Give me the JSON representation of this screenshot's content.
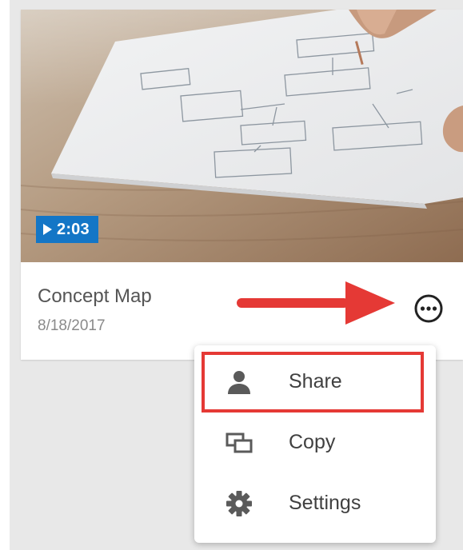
{
  "video": {
    "duration": "2:03",
    "title": "Concept Map",
    "date": "8/18/2017",
    "thumbnail_icon": "sketch-flowchart-photo"
  },
  "more_options": {
    "icon": "more-horizontal-circle-icon"
  },
  "menu": {
    "items": [
      {
        "label": "Share",
        "icon": "person-icon"
      },
      {
        "label": "Copy",
        "icon": "copy-windows-icon"
      },
      {
        "label": "Settings",
        "icon": "gear-icon"
      }
    ]
  },
  "colors": {
    "badge": "#1476c6",
    "annotation": "#e53935",
    "text_primary": "#555555",
    "text_secondary": "#8a8a8a"
  }
}
